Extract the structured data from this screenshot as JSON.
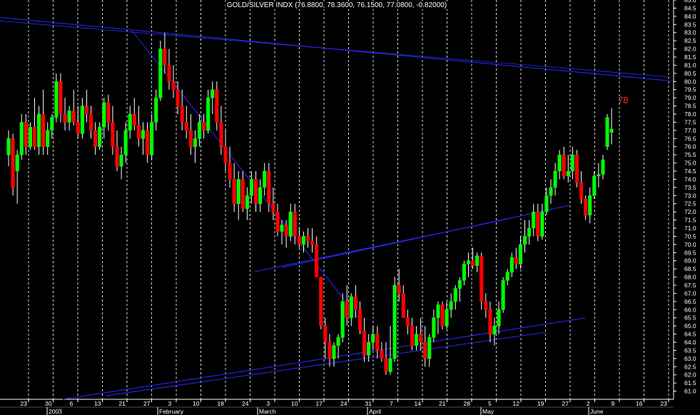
{
  "colors": {
    "background": "#000000",
    "up": "#00ff00",
    "down": "#ff0000",
    "wick": "#ffffff",
    "grid": "#ffffff",
    "trendline": "#2b2bff",
    "text": "#ffffff",
    "annotation": "#ff3030"
  },
  "chart_data": {
    "type": "candlestick",
    "title": "GOLD/SILVER INDX (76.8800, 78.3600, 76.1500, 77.0800, -0.82000)",
    "ylim": [
      60.5,
      85.0
    ],
    "y_ticks": [
      "61.0",
      "61.5",
      "62.0",
      "62.5",
      "63.0",
      "63.5",
      "64.0",
      "64.5",
      "65.0",
      "65.5",
      "66.0",
      "66.5",
      "67.0",
      "67.5",
      "68.0",
      "68.5",
      "69.0",
      "69.5",
      "70.0",
      "70.5",
      "71.0",
      "71.5",
      "72.0",
      "72.5",
      "73.0",
      "73.5",
      "74.0",
      "74.5",
      "75.0",
      "75.5",
      "76.0",
      "76.5",
      "77.0",
      "77.5",
      "78.0",
      "78.5",
      "79.0",
      "79.5",
      "80.0",
      "80.5",
      "81.0",
      "81.5",
      "82.0",
      "82.5",
      "83.0",
      "83.5",
      "84.0",
      "84.5",
      "85.0"
    ],
    "x_day_labels": [
      "23",
      "30",
      "6",
      "13",
      "21",
      "27",
      "3",
      "10",
      "18",
      "24",
      "3",
      "10",
      "17",
      "24",
      "31",
      "7",
      "14",
      "21",
      "28",
      "5",
      "12",
      "19",
      "27",
      "2",
      "9",
      "16",
      "23"
    ],
    "x_month_labels": [
      "2003",
      "February",
      "March",
      "April",
      "May",
      "June"
    ],
    "annotation": "78",
    "candles": [
      [
        75.5,
        77.0,
        74.8,
        76.5
      ],
      [
        76.5,
        76.8,
        73.0,
        73.5
      ],
      [
        74.5,
        75.8,
        72.5,
        75.5
      ],
      [
        75.5,
        78.0,
        75.2,
        77.5
      ],
      [
        77.5,
        78.0,
        75.5,
        76.0
      ],
      [
        76.0,
        77.5,
        75.8,
        77.2
      ],
      [
        77.2,
        79.0,
        75.8,
        76.0
      ],
      [
        76.0,
        78.5,
        75.5,
        78.0
      ],
      [
        78.0,
        79.5,
        75.5,
        76.0
      ],
      [
        76.0,
        77.5,
        75.5,
        77.0
      ],
      [
        77.0,
        78.0,
        76.5,
        77.8
      ],
      [
        77.8,
        80.5,
        77.5,
        80.0
      ],
      [
        80.0,
        80.5,
        77.5,
        78.0
      ],
      [
        78.0,
        79.0,
        77.0,
        77.5
      ],
      [
        77.5,
        78.5,
        77.0,
        78.2
      ],
      [
        78.2,
        79.5,
        77.3,
        77.5
      ],
      [
        77.5,
        78.5,
        76.5,
        76.8
      ],
      [
        76.8,
        79.0,
        76.5,
        78.5
      ],
      [
        78.5,
        79.5,
        77.5,
        78.0
      ],
      [
        78.0,
        78.5,
        76.5,
        77.0
      ],
      [
        77.0,
        77.5,
        75.5,
        76.0
      ],
      [
        76.0,
        77.5,
        75.8,
        77.2
      ],
      [
        77.2,
        79.0,
        76.5,
        78.7
      ],
      [
        78.7,
        79.2,
        77.0,
        77.5
      ],
      [
        77.5,
        78.5,
        75.5,
        76.0
      ],
      [
        76.0,
        77.0,
        74.5,
        74.8
      ],
      [
        74.8,
        76.0,
        74.0,
        75.5
      ],
      [
        75.5,
        77.5,
        75.0,
        77.0
      ],
      [
        77.0,
        78.5,
        76.5,
        78.0
      ],
      [
        78.0,
        79.0,
        77.0,
        77.3
      ],
      [
        77.3,
        78.5,
        76.0,
        76.5
      ],
      [
        76.5,
        77.5,
        75.5,
        77.0
      ],
      [
        77.0,
        77.5,
        75.0,
        75.5
      ],
      [
        75.5,
        78.0,
        75.2,
        77.5
      ],
      [
        77.5,
        79.5,
        77.0,
        79.0
      ],
      [
        79.0,
        82.5,
        78.8,
        82.0
      ],
      [
        82.0,
        83.0,
        80.5,
        81.0
      ],
      [
        81.0,
        82.0,
        79.5,
        80.0
      ],
      [
        80.0,
        81.0,
        79.0,
        79.5
      ],
      [
        79.5,
        80.0,
        78.0,
        78.5
      ],
      [
        78.5,
        79.5,
        77.0,
        77.5
      ],
      [
        77.5,
        78.5,
        76.5,
        77.0
      ],
      [
        77.0,
        78.0,
        75.5,
        76.0
      ],
      [
        76.0,
        77.0,
        75.0,
        76.5
      ],
      [
        76.5,
        78.0,
        76.0,
        77.5
      ],
      [
        77.5,
        78.0,
        76.5,
        77.0
      ],
      [
        77.0,
        79.5,
        76.8,
        79.0
      ],
      [
        79.0,
        80.0,
        78.0,
        79.5
      ],
      [
        79.5,
        80.0,
        77.0,
        77.5
      ],
      [
        77.5,
        78.5,
        75.5,
        76.0
      ],
      [
        76.0,
        77.0,
        74.5,
        75.0
      ],
      [
        75.0,
        76.0,
        73.5,
        74.0
      ],
      [
        74.0,
        75.0,
        72.0,
        72.5
      ],
      [
        72.5,
        74.5,
        71.5,
        74.0
      ],
      [
        74.0,
        74.5,
        72.0,
        72.2
      ],
      [
        72.2,
        73.5,
        71.5,
        73.0
      ],
      [
        73.0,
        74.5,
        72.5,
        74.0
      ],
      [
        74.0,
        74.5,
        72.0,
        72.5
      ],
      [
        72.5,
        74.0,
        72.0,
        73.5
      ],
      [
        73.5,
        75.0,
        73.0,
        74.5
      ],
      [
        74.5,
        75.0,
        72.0,
        72.5
      ],
      [
        72.5,
        73.5,
        71.5,
        72.0
      ],
      [
        72.0,
        72.5,
        70.5,
        70.8
      ],
      [
        70.8,
        71.5,
        70.0,
        71.2
      ],
      [
        71.2,
        71.5,
        69.8,
        70.5
      ],
      [
        70.5,
        72.5,
        70.2,
        72.0
      ],
      [
        72.0,
        72.5,
        70.0,
        70.5
      ],
      [
        70.5,
        71.0,
        69.8,
        70.0
      ],
      [
        70.0,
        70.8,
        69.5,
        70.5
      ],
      [
        70.5,
        71.0,
        69.8,
        70.2
      ],
      [
        70.2,
        71.0,
        69.5,
        70.0
      ],
      [
        70.0,
        70.5,
        68.0,
        68.0
      ],
      [
        68.0,
        68.0,
        64.8,
        65.0
      ],
      [
        65.0,
        65.5,
        63.0,
        64.0
      ],
      [
        64.0,
        64.5,
        62.5,
        63.0
      ],
      [
        63.0,
        64.0,
        62.5,
        63.8
      ],
      [
        63.8,
        64.5,
        63.0,
        64.3
      ],
      [
        64.3,
        67.0,
        64.0,
        66.5
      ],
      [
        66.5,
        67.5,
        65.0,
        65.5
      ],
      [
        65.5,
        67.0,
        65.0,
        66.8
      ],
      [
        66.8,
        67.5,
        65.5,
        66.0
      ],
      [
        66.0,
        66.5,
        64.5,
        64.7
      ],
      [
        64.7,
        65.5,
        62.8,
        63.2
      ],
      [
        63.2,
        64.5,
        62.8,
        64.0
      ],
      [
        64.0,
        65.0,
        63.5,
        64.5
      ],
      [
        64.5,
        65.0,
        63.0,
        63.5
      ],
      [
        63.5,
        64.0,
        62.8,
        63.0
      ],
      [
        63.0,
        64.0,
        62.0,
        62.2
      ],
      [
        62.2,
        65.0,
        62.0,
        63.0
      ],
      [
        63.0,
        68.0,
        62.8,
        67.5
      ],
      [
        67.5,
        68.5,
        66.5,
        67.0
      ],
      [
        67.0,
        67.5,
        65.5,
        65.5
      ],
      [
        65.5,
        66.0,
        64.5,
        65.0
      ],
      [
        65.0,
        65.5,
        63.5,
        63.8
      ],
      [
        63.8,
        65.0,
        63.5,
        64.5
      ],
      [
        64.5,
        65.5,
        63.5,
        64.0
      ],
      [
        64.0,
        65.0,
        62.5,
        63.0
      ],
      [
        63.0,
        64.5,
        62.5,
        64.3
      ],
      [
        64.3,
        66.0,
        64.0,
        65.5
      ],
      [
        65.5,
        66.5,
        64.5,
        66.3
      ],
      [
        66.3,
        66.5,
        64.8,
        65.0
      ],
      [
        65.0,
        66.5,
        64.8,
        66.0
      ],
      [
        66.0,
        67.0,
        65.5,
        66.5
      ],
      [
        66.5,
        67.5,
        66.0,
        67.3
      ],
      [
        67.3,
        68.0,
        66.5,
        67.8
      ],
      [
        67.8,
        69.0,
        67.5,
        68.8
      ],
      [
        68.8,
        69.5,
        68.0,
        69.0
      ],
      [
        69.0,
        69.8,
        68.5,
        68.7
      ],
      [
        68.7,
        69.5,
        68.3,
        69.3
      ],
      [
        69.3,
        69.5,
        66.0,
        66.5
      ],
      [
        66.5,
        67.0,
        65.5,
        66.0
      ],
      [
        66.0,
        66.5,
        64.0,
        64.5
      ],
      [
        64.5,
        65.5,
        63.8,
        65.0
      ],
      [
        65.0,
        66.5,
        64.5,
        66.0
      ],
      [
        66.0,
        68.0,
        65.8,
        67.8
      ],
      [
        67.8,
        68.5,
        67.5,
        68.3
      ],
      [
        68.3,
        69.5,
        68.0,
        69.2
      ],
      [
        69.2,
        69.8,
        68.5,
        68.8
      ],
      [
        68.8,
        70.5,
        68.5,
        70.0
      ],
      [
        70.0,
        71.5,
        69.5,
        70.5
      ],
      [
        70.5,
        71.5,
        70.0,
        71.0
      ],
      [
        71.0,
        72.5,
        70.5,
        72.0
      ],
      [
        72.0,
        72.5,
        70.2,
        70.5
      ],
      [
        70.5,
        72.5,
        70.3,
        72.0
      ],
      [
        72.0,
        73.5,
        71.8,
        73.0
      ],
      [
        73.0,
        74.0,
        72.5,
        73.5
      ],
      [
        73.5,
        75.0,
        73.0,
        74.5
      ],
      [
        74.5,
        75.8,
        74.0,
        75.5
      ],
      [
        75.5,
        76.0,
        74.0,
        74.2
      ],
      [
        74.2,
        75.5,
        73.8,
        74.5
      ],
      [
        74.5,
        76.0,
        74.0,
        75.5
      ],
      [
        75.5,
        75.8,
        73.5,
        73.8
      ],
      [
        73.8,
        74.5,
        72.5,
        72.8
      ],
      [
        72.8,
        73.0,
        71.5,
        71.8
      ],
      [
        71.8,
        73.5,
        71.3,
        73.0
      ],
      [
        73.0,
        74.5,
        72.8,
        74.2
      ],
      [
        74.2,
        75.0,
        73.5,
        74.3
      ],
      [
        74.3,
        75.5,
        74.0,
        75.2
      ],
      [
        76.0,
        78.0,
        75.8,
        77.8
      ],
      [
        76.88,
        78.36,
        76.15,
        77.08
      ]
    ]
  }
}
